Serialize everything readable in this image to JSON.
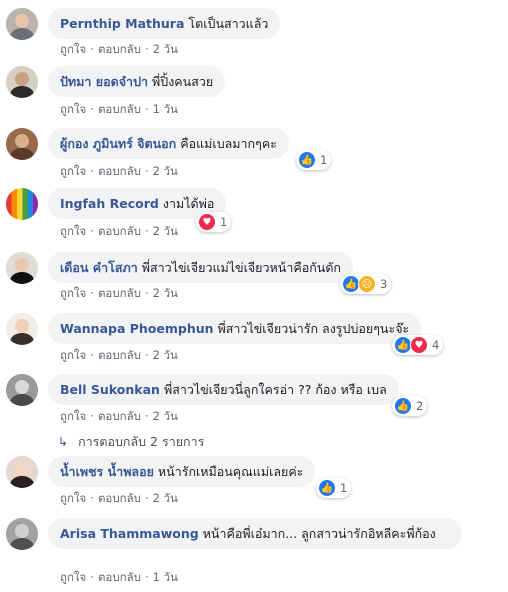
{
  "comments": [
    {
      "author": "Pernthip Mathura",
      "text": "โตเป็นสาวแล้ว",
      "like": "ถูกใจ",
      "reply": "ตอบกลับ",
      "time": "2 วัน",
      "reactions": [],
      "reaction_count": ""
    },
    {
      "author": "ปัทมา ยอดจำปา",
      "text": "พี่ปิ้งคนสวย",
      "like": "ถูกใจ",
      "reply": "ตอบกลับ",
      "time": "1 วัน",
      "reactions": [],
      "reaction_count": ""
    },
    {
      "author": "ผู้กอง ภูมินทร์ จิตนอก",
      "text": "คือแม่เบลมากๆคะ",
      "like": "ถูกใจ",
      "reply": "ตอบกลับ",
      "time": "2 วัน",
      "reactions": [
        "like"
      ],
      "reaction_count": "1"
    },
    {
      "author": "Ingfah Record",
      "text": "งามได้พ่อ",
      "like": "ถูกใจ",
      "reply": "ตอบกลับ",
      "time": "2 วัน",
      "reactions": [
        "love"
      ],
      "reaction_count": "1"
    },
    {
      "author": "เดือน คำโสภา",
      "text": "พี่สาวไข่เจียวแม่ไข่เจียวหน้าคือกันดัก",
      "like": "ถูกใจ",
      "reply": "ตอบกลับ",
      "time": "2 วัน",
      "reactions": [
        "like",
        "angry"
      ],
      "reaction_count": "3"
    },
    {
      "author": "Wannapa Phoemphun",
      "text": "พี่สาวไข่เจียวน่ารัก ลงรูปบ่อยๆนะจ๊ะ",
      "like": "ถูกใจ",
      "reply": "ตอบกลับ",
      "time": "2 วัน",
      "reactions": [
        "like",
        "love"
      ],
      "reaction_count": "4"
    },
    {
      "author": "Bell Sukonkan",
      "text": "พี่สาวไข่เจียวนี่ลูกใครอ่า ?? ก้อง หรือ เบล",
      "like": "ถูกใจ",
      "reply": "ตอบกลับ",
      "time": "2 วัน",
      "reactions": [
        "like"
      ],
      "reaction_count": "2"
    },
    {
      "author": "น้ำเพชร น้ำพลอย",
      "text": "หน้ารักเหมือนคุณแม่เลยค่ะ",
      "like": "ถูกใจ",
      "reply": "ตอบกลับ",
      "time": "2 วัน",
      "reactions": [
        "like"
      ],
      "reaction_count": "1"
    },
    {
      "author": "Arisa Thammawong",
      "text": "หน้าคือพี่เอ๋มาก... ลูกสาวน่ารักอิหลีคะพี่ก้อง",
      "like": "ถูกใจ",
      "reply": "ตอบกลับ",
      "time": "1 วัน",
      "reactions": [],
      "reaction_count": ""
    }
  ],
  "replies_link": {
    "icon": "reply-arrow-icon",
    "label": "การตอบกลับ 2 รายการ"
  },
  "colors": {
    "author": "#385898",
    "bubble": "#f2f3f5",
    "meta": "#606770",
    "like": "#2078f4",
    "love": "#f0284a",
    "angry": "#f7b125"
  }
}
